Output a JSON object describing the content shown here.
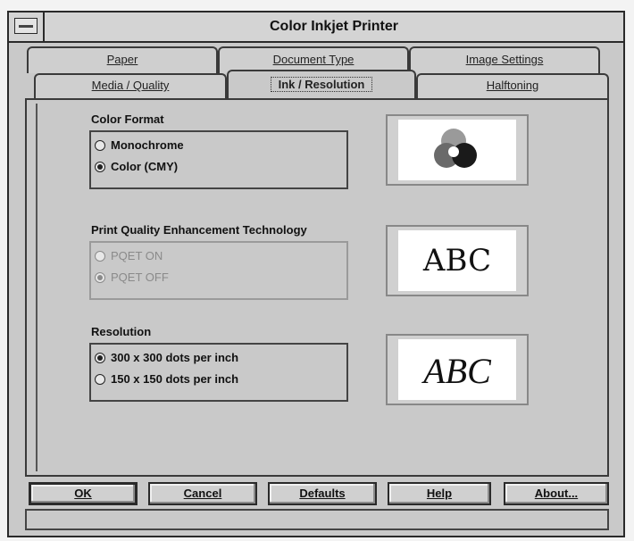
{
  "window": {
    "title": "Color Inkjet Printer"
  },
  "tabs": {
    "back": [
      {
        "label": "Paper"
      },
      {
        "label": "Document Type"
      },
      {
        "label": "Image Settings"
      }
    ],
    "front": [
      {
        "label": "Media / Quality"
      },
      {
        "label": "Ink / Resolution"
      },
      {
        "label": "Halftoning"
      }
    ],
    "active": "Ink / Resolution"
  },
  "color_format": {
    "label": "Color Format",
    "options": [
      {
        "label": "Monochrome",
        "selected": false
      },
      {
        "label": "Color (CMY)",
        "selected": true
      }
    ]
  },
  "pqet": {
    "label": "Print Quality Enhancement Technology",
    "enabled": false,
    "options": [
      {
        "label": "PQET ON",
        "selected": false
      },
      {
        "label": "PQET OFF",
        "selected": true
      }
    ]
  },
  "resolution": {
    "label": "Resolution",
    "options": [
      {
        "label": "300 x 300 dots per inch",
        "selected": true
      },
      {
        "label": "150 x 150 dots per inch",
        "selected": false
      }
    ]
  },
  "previews": {
    "pqet_text": "ABC",
    "resolution_text": "ABC",
    "color_icon": "cmy-circles-icon"
  },
  "buttons": {
    "ok": "OK",
    "cancel": "Cancel",
    "defaults": "Defaults",
    "help": "Help",
    "about": "About..."
  },
  "colors": {
    "dialog_bg": "#c9c9c9",
    "border": "#2a2a2a",
    "disabled_text": "#8a8a8a"
  }
}
